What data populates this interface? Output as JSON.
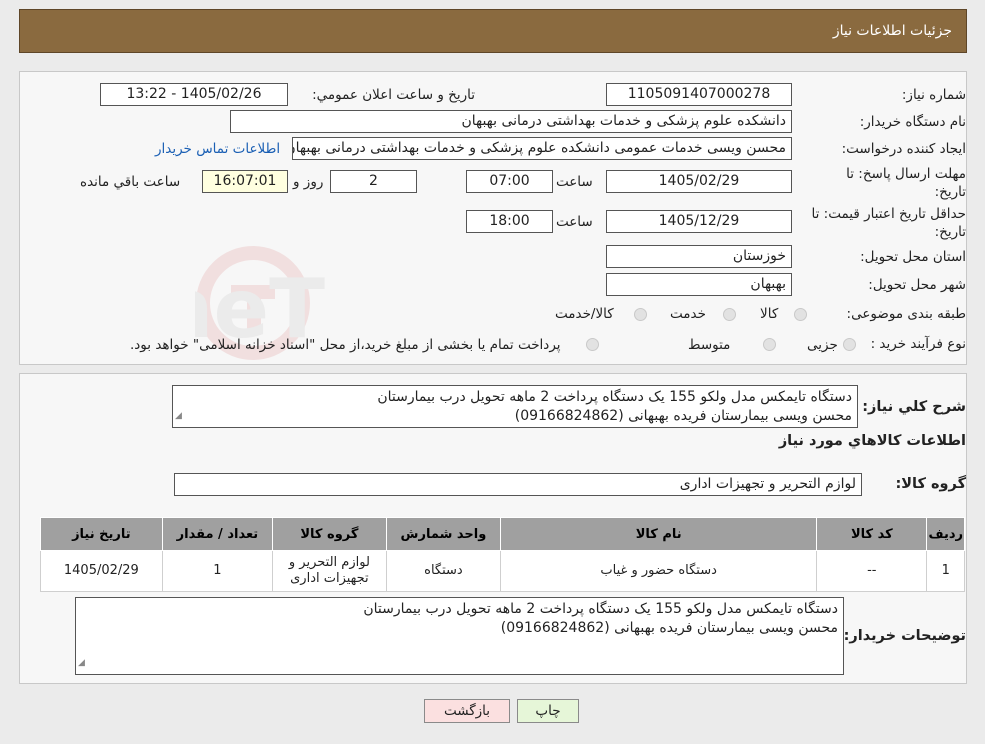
{
  "header": {
    "title": "جزئیات اطلاعات نیاز"
  },
  "need_number": {
    "label": "شماره نیاز:",
    "value": "1105091407000278"
  },
  "announce_datetime": {
    "label": "تاریخ و ساعت اعلان عمومي:",
    "value": "1405/02/26 - 13:22"
  },
  "buyer_org": {
    "label": "نام دستگاه خریدار:",
    "value": "دانشکده علوم پزشکی و خدمات بهداشتی  درمانی بهبهان"
  },
  "creator": {
    "label": "ایجاد کننده درخواست:",
    "value": "محسن ویسی خدمات عمومی دانشکده علوم پزشکی و خدمات بهداشتی  درمانی بهبهان",
    "contact_link": "اطلاعات تماس خریدار"
  },
  "reply_deadline": {
    "label_line1": "مهلت ارسال پاسخ: تا",
    "label_line2": "تاریخ:",
    "date": "1405/02/29",
    "time_label": "ساعت",
    "time": "07:00",
    "days": "2",
    "days_label": "روز و",
    "remaining": "16:07:01",
    "remaining_label": "ساعت باقي مانده"
  },
  "price_validity": {
    "label_line1": "حداقل تاریخ اعتبار قیمت: تا",
    "label_line2": "تاریخ:",
    "date": "1405/12/29",
    "time_label": "ساعت",
    "time": "18:00"
  },
  "province": {
    "label": "استان محل تحویل:",
    "value": "خوزستان"
  },
  "city": {
    "label": "شهر محل تحویل:",
    "value": "بهبهان"
  },
  "category": {
    "label": "طبقه بندی موضوعی:",
    "options": [
      "کالا",
      "خدمت",
      "کالا/خدمت"
    ]
  },
  "purchase_type": {
    "label": "نوع فرآیند خرید :",
    "options": [
      "جزیی",
      "متوسط"
    ],
    "note": "پرداخت تمام یا بخشی از مبلغ خرید،از محل \"اسناد خزانه اسلامی\" خواهد بود."
  },
  "watermark": {
    "text": "AriaTender.neT"
  },
  "description": {
    "label": "شرح کلي نیاز:",
    "line1": "دستگاه تایمکس مدل ولکو 155 یک دستگاه پرداخت 2 ماهه تحویل درب بیمارستان",
    "line2": "محسن ویسی بیمارستان فریده بهبهانی (09166824862)"
  },
  "goods_section": {
    "title": "اطلاعات کالاهاي مورد نیاز"
  },
  "goods_group": {
    "label": "گروه کالا:",
    "value": "لوازم التحریر و تجهیزات اداری"
  },
  "table": {
    "headers": [
      "ردیف",
      "کد کالا",
      "نام کالا",
      "واحد شمارش",
      "گروه کالا",
      "تعداد / مقدار",
      "تاریخ نیاز"
    ],
    "rows": [
      {
        "row": "1",
        "code": "--",
        "name": "دستگاه حضور و غیاب",
        "unit": "دستگاه",
        "group_line1": "لوازم التحریر و",
        "group_line2": "تجهیزات اداری",
        "qty": "1",
        "date": "1405/02/29"
      }
    ]
  },
  "buyer_notes": {
    "label": "توضیحات خریدار:",
    "line1": "دستگاه تایمکس مدل ولکو 155 یک دستگاه پرداخت 2 ماهه تحویل درب بیمارستان",
    "line2": "محسن ویسی بیمارستان فریده بهبهانی (09166824862)"
  },
  "buttons": {
    "print": "چاپ",
    "back": "بازگشت"
  },
  "colors": {
    "header_bg": "#8a6a3f",
    "print_bg": "#e6f6d8",
    "back_bg": "#fbe0e0",
    "time_bg": "#ffffe0",
    "link": "#1a5fb4"
  }
}
